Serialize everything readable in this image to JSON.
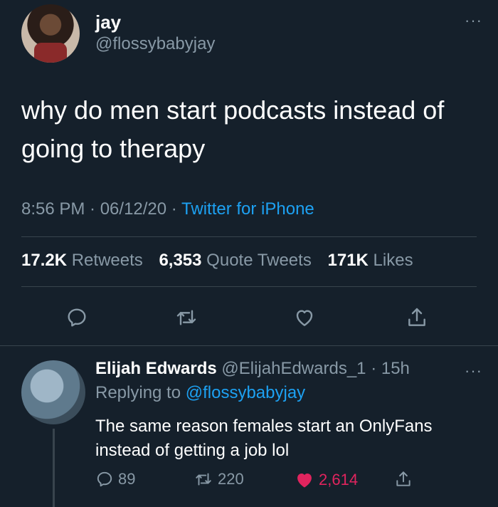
{
  "tweet": {
    "name": "jay",
    "handle": "@flossybabyjay",
    "more": "···",
    "text": "why do men start podcasts instead of going to therapy",
    "time": "8:56 PM · 06/12/20 · ",
    "source": "Twitter for iPhone",
    "stats": {
      "retweets_count": "17.2K",
      "retweets_label": "Retweets",
      "quotes_count": "6,353",
      "quotes_label": "Quote Tweets",
      "likes_count": "171K",
      "likes_label": "Likes"
    },
    "actions": [
      "reply-icon",
      "retweet-icon",
      "like-icon",
      "share-icon"
    ]
  },
  "reply": {
    "name": "Elijah Edwards",
    "handle": "@ElijahEdwards_1 · 15h",
    "more": "···",
    "replying_prefix": "Replying to ",
    "replying_to": "@flossybabyjay",
    "text": "The same reason females start an OnlyFans instead of getting a job lol",
    "replies": "89",
    "retweets": "220",
    "likes": "2,614"
  },
  "colors": {
    "background": "#15202b",
    "secondary_text": "#8899a6",
    "link": "#1da1f2",
    "like": "#e0245e",
    "divider": "#38444d"
  }
}
